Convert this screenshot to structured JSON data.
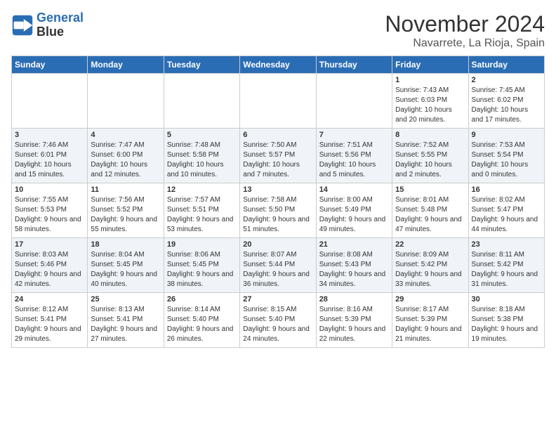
{
  "logo": {
    "line1": "General",
    "line2": "Blue"
  },
  "title": "November 2024",
  "location": "Navarrete, La Rioja, Spain",
  "days_of_week": [
    "Sunday",
    "Monday",
    "Tuesday",
    "Wednesday",
    "Thursday",
    "Friday",
    "Saturday"
  ],
  "weeks": [
    [
      {
        "day": "",
        "data": ""
      },
      {
        "day": "",
        "data": ""
      },
      {
        "day": "",
        "data": ""
      },
      {
        "day": "",
        "data": ""
      },
      {
        "day": "",
        "data": ""
      },
      {
        "day": "1",
        "data": "Sunrise: 7:43 AM\nSunset: 6:03 PM\nDaylight: 10 hours and 20 minutes."
      },
      {
        "day": "2",
        "data": "Sunrise: 7:45 AM\nSunset: 6:02 PM\nDaylight: 10 hours and 17 minutes."
      }
    ],
    [
      {
        "day": "3",
        "data": "Sunrise: 7:46 AM\nSunset: 6:01 PM\nDaylight: 10 hours and 15 minutes."
      },
      {
        "day": "4",
        "data": "Sunrise: 7:47 AM\nSunset: 6:00 PM\nDaylight: 10 hours and 12 minutes."
      },
      {
        "day": "5",
        "data": "Sunrise: 7:48 AM\nSunset: 5:58 PM\nDaylight: 10 hours and 10 minutes."
      },
      {
        "day": "6",
        "data": "Sunrise: 7:50 AM\nSunset: 5:57 PM\nDaylight: 10 hours and 7 minutes."
      },
      {
        "day": "7",
        "data": "Sunrise: 7:51 AM\nSunset: 5:56 PM\nDaylight: 10 hours and 5 minutes."
      },
      {
        "day": "8",
        "data": "Sunrise: 7:52 AM\nSunset: 5:55 PM\nDaylight: 10 hours and 2 minutes."
      },
      {
        "day": "9",
        "data": "Sunrise: 7:53 AM\nSunset: 5:54 PM\nDaylight: 10 hours and 0 minutes."
      }
    ],
    [
      {
        "day": "10",
        "data": "Sunrise: 7:55 AM\nSunset: 5:53 PM\nDaylight: 9 hours and 58 minutes."
      },
      {
        "day": "11",
        "data": "Sunrise: 7:56 AM\nSunset: 5:52 PM\nDaylight: 9 hours and 55 minutes."
      },
      {
        "day": "12",
        "data": "Sunrise: 7:57 AM\nSunset: 5:51 PM\nDaylight: 9 hours and 53 minutes."
      },
      {
        "day": "13",
        "data": "Sunrise: 7:58 AM\nSunset: 5:50 PM\nDaylight: 9 hours and 51 minutes."
      },
      {
        "day": "14",
        "data": "Sunrise: 8:00 AM\nSunset: 5:49 PM\nDaylight: 9 hours and 49 minutes."
      },
      {
        "day": "15",
        "data": "Sunrise: 8:01 AM\nSunset: 5:48 PM\nDaylight: 9 hours and 47 minutes."
      },
      {
        "day": "16",
        "data": "Sunrise: 8:02 AM\nSunset: 5:47 PM\nDaylight: 9 hours and 44 minutes."
      }
    ],
    [
      {
        "day": "17",
        "data": "Sunrise: 8:03 AM\nSunset: 5:46 PM\nDaylight: 9 hours and 42 minutes."
      },
      {
        "day": "18",
        "data": "Sunrise: 8:04 AM\nSunset: 5:45 PM\nDaylight: 9 hours and 40 minutes."
      },
      {
        "day": "19",
        "data": "Sunrise: 8:06 AM\nSunset: 5:45 PM\nDaylight: 9 hours and 38 minutes."
      },
      {
        "day": "20",
        "data": "Sunrise: 8:07 AM\nSunset: 5:44 PM\nDaylight: 9 hours and 36 minutes."
      },
      {
        "day": "21",
        "data": "Sunrise: 8:08 AM\nSunset: 5:43 PM\nDaylight: 9 hours and 34 minutes."
      },
      {
        "day": "22",
        "data": "Sunrise: 8:09 AM\nSunset: 5:42 PM\nDaylight: 9 hours and 33 minutes."
      },
      {
        "day": "23",
        "data": "Sunrise: 8:11 AM\nSunset: 5:42 PM\nDaylight: 9 hours and 31 minutes."
      }
    ],
    [
      {
        "day": "24",
        "data": "Sunrise: 8:12 AM\nSunset: 5:41 PM\nDaylight: 9 hours and 29 minutes."
      },
      {
        "day": "25",
        "data": "Sunrise: 8:13 AM\nSunset: 5:41 PM\nDaylight: 9 hours and 27 minutes."
      },
      {
        "day": "26",
        "data": "Sunrise: 8:14 AM\nSunset: 5:40 PM\nDaylight: 9 hours and 26 minutes."
      },
      {
        "day": "27",
        "data": "Sunrise: 8:15 AM\nSunset: 5:40 PM\nDaylight: 9 hours and 24 minutes."
      },
      {
        "day": "28",
        "data": "Sunrise: 8:16 AM\nSunset: 5:39 PM\nDaylight: 9 hours and 22 minutes."
      },
      {
        "day": "29",
        "data": "Sunrise: 8:17 AM\nSunset: 5:39 PM\nDaylight: 9 hours and 21 minutes."
      },
      {
        "day": "30",
        "data": "Sunrise: 8:18 AM\nSunset: 5:38 PM\nDaylight: 9 hours and 19 minutes."
      }
    ]
  ]
}
